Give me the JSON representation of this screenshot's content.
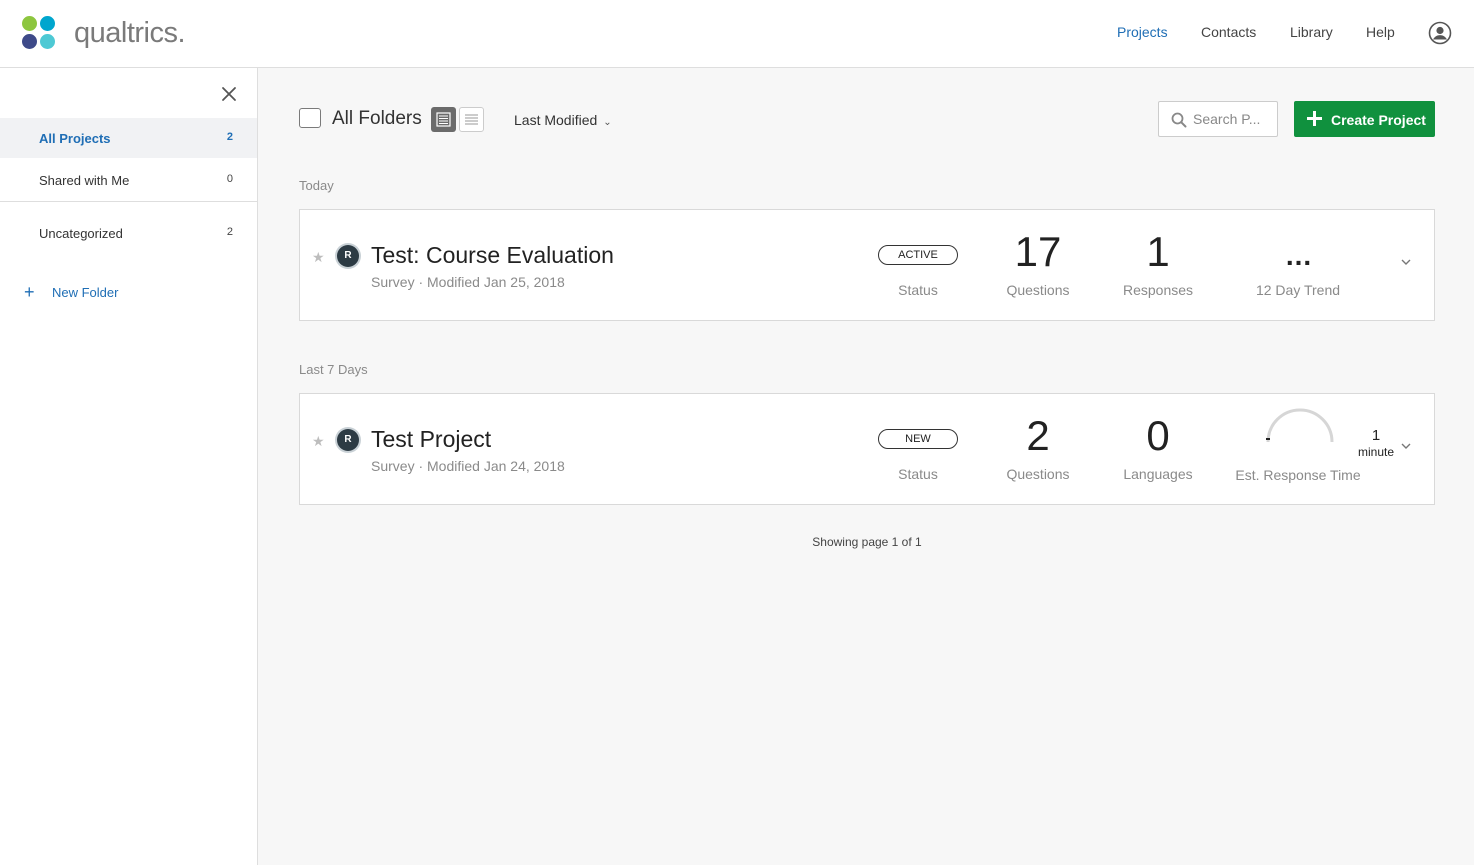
{
  "brand": {
    "name": "qualtrics.",
    "dot_colors": [
      "#8dc63f",
      "#00a6ce",
      "#3e4a89",
      "#4ec9d4"
    ]
  },
  "topnav": {
    "items": [
      {
        "label": "Projects",
        "active": true
      },
      {
        "label": "Contacts"
      },
      {
        "label": "Library"
      },
      {
        "label": "Help"
      }
    ],
    "user_icon": "user-circle-icon"
  },
  "sidebar": {
    "close_icon": "close-icon",
    "items": [
      {
        "label": "All Projects",
        "count": "2",
        "selected": true
      },
      {
        "label": "Shared with Me",
        "count": "0"
      },
      {
        "label": "Uncategorized",
        "count": "2"
      }
    ],
    "new_folder_label": "New Folder"
  },
  "toolbar": {
    "folder_title": "All Folders",
    "sort_label": "Last Modified",
    "search_placeholder": "Search P...",
    "create_label": "Create Project"
  },
  "sections": [
    {
      "label": "Today",
      "project": {
        "title": "Test: Course Evaluation",
        "badge": "R",
        "subtitle": "Survey · Modified Jan 25, 2018",
        "status": "ACTIVE",
        "status_label": "Status",
        "metric1_value": "17",
        "metric1_label": "Questions",
        "metric2_value": "1",
        "metric2_label": "Responses",
        "metric3_value": "...",
        "metric3_label": "12 Day Trend"
      }
    },
    {
      "label": "Last 7 Days",
      "project": {
        "title": "Test Project",
        "badge": "R",
        "subtitle": "Survey · Modified Jan 24, 2018",
        "status": "NEW",
        "status_label": "Status",
        "metric1_value": "2",
        "metric1_label": "Questions",
        "metric2_value": "0",
        "metric2_label": "Languages",
        "gauge_value": "1",
        "gauge_unit": "minute",
        "metric3_label": "Est. Response Time"
      }
    }
  ],
  "pager": "Showing page 1 of 1",
  "colors": {
    "accent": "#1f6eb5",
    "create_button": "#10913e"
  }
}
